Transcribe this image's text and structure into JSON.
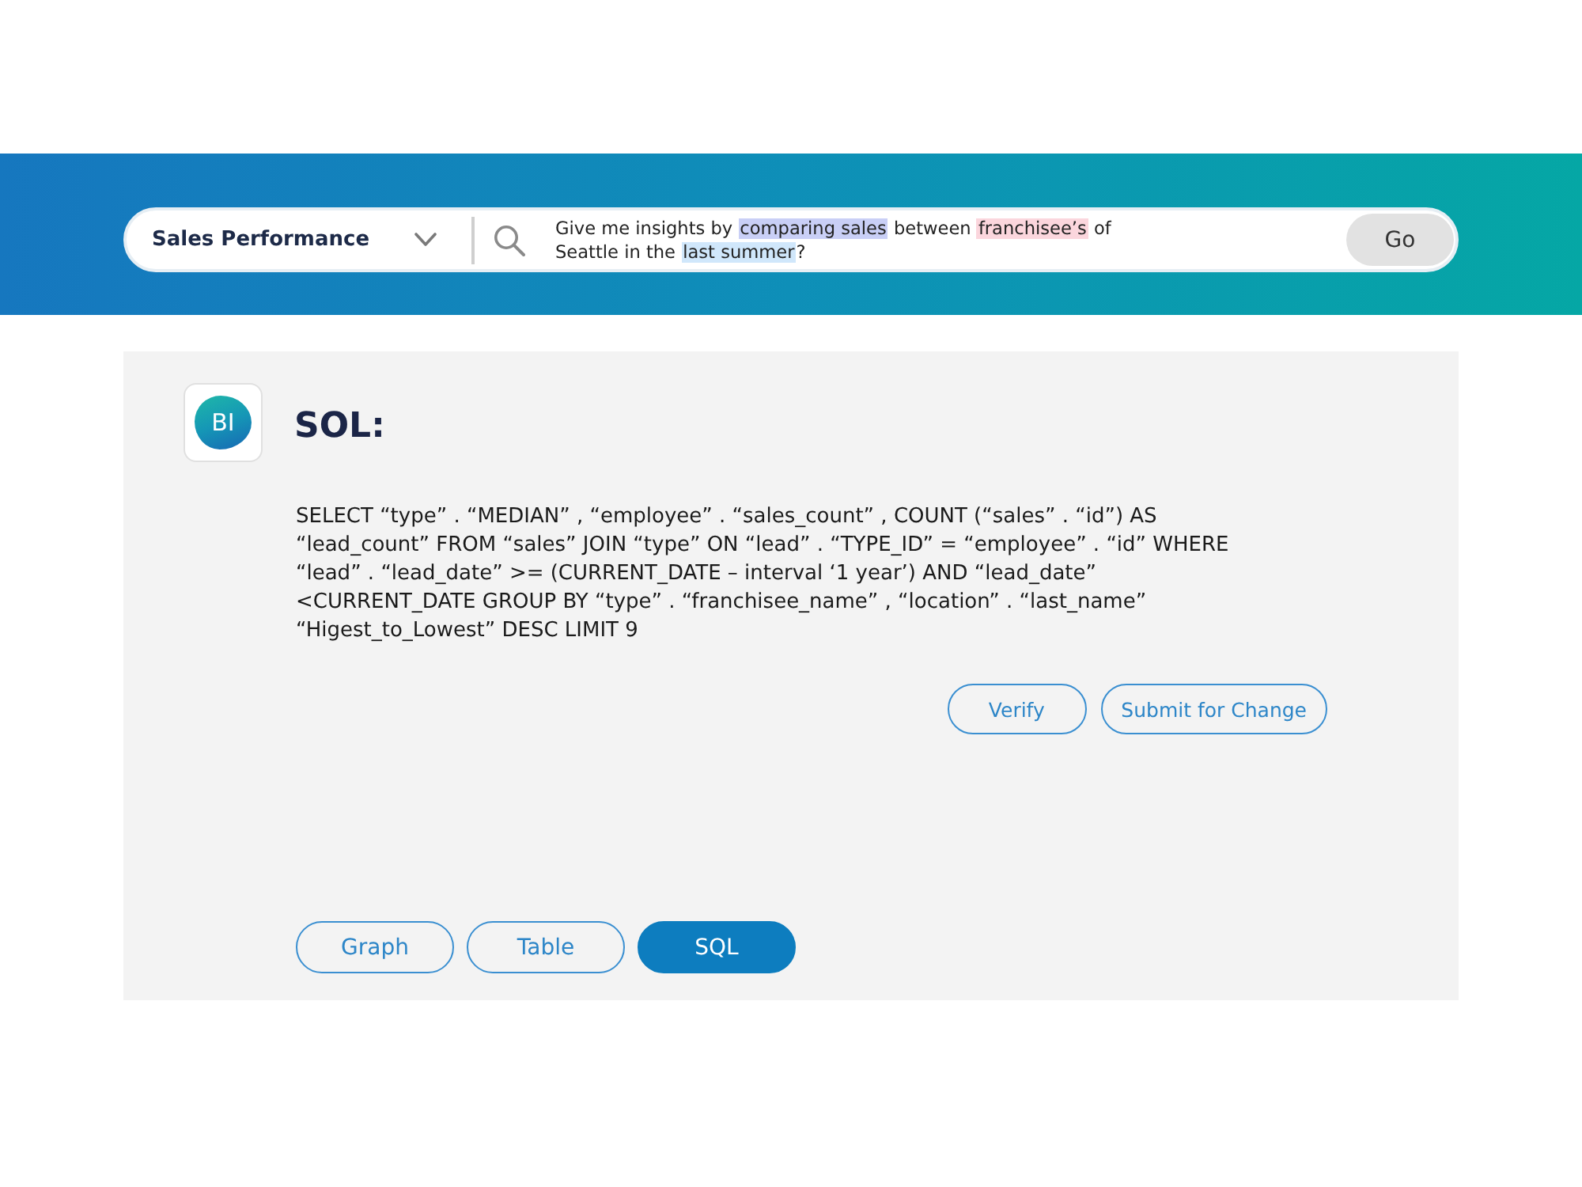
{
  "header": {
    "dataset": {
      "label": "Sales Performance"
    },
    "query": [
      {
        "text": "Give me insights by "
      },
      {
        "text": "comparing sales",
        "color": "#c9cff6"
      },
      {
        "text": " between "
      },
      {
        "text": "franchisee’s",
        "color": "#fbd6dd"
      },
      {
        "text": " of\nSeattle in the "
      },
      {
        "text": "last summer",
        "color": "#d0e7fb"
      },
      {
        "text": "?"
      }
    ],
    "go_button": "Go"
  },
  "panel": {
    "logo": "BI",
    "title": "SOL:",
    "sql": "SELECT “type” . “MEDIAN” , “employee” . “sales_count” , COUNT (“sales” . “id”) AS\n“lead_count” FROM “sales” JOIN “type” ON “lead” . “TYPE_ID” = “employee” . “id” WHERE\n“lead” . “lead_date” >= (CURRENT_DATE – interval ‘1 year’) AND “lead_date”\n<CURRENT_DATE GROUP BY “type” . “franchisee_name” , “location” . “last_name”\n“Higest_to_Lowest” DESC LIMIT 9",
    "actions": [
      "Verify",
      "Submit for Change"
    ],
    "view_tabs": [
      {
        "label": "Graph",
        "selected": false
      },
      {
        "label": "Table",
        "selected": false
      },
      {
        "label": "SQL",
        "selected": true
      }
    ]
  }
}
